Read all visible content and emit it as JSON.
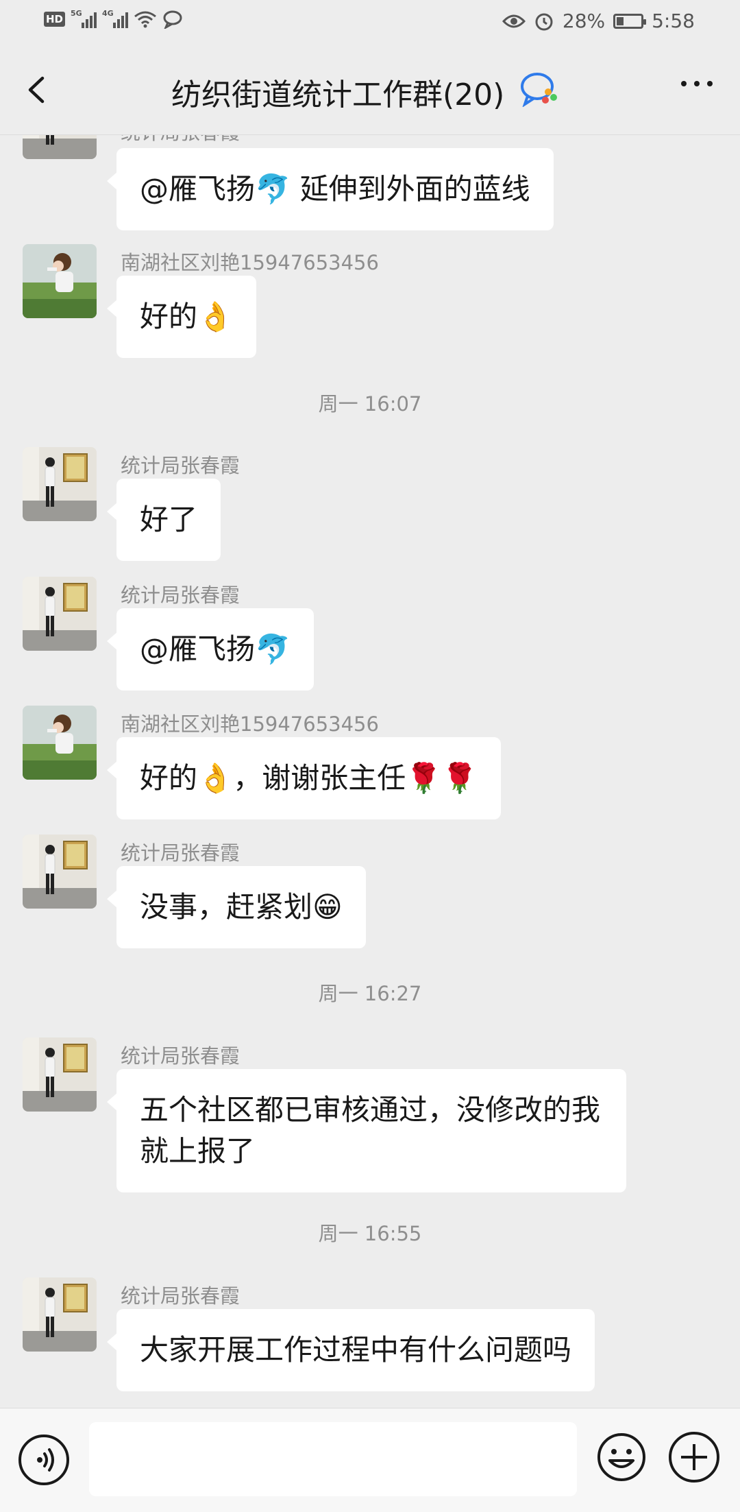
{
  "status_bar": {
    "left_badge": "HD",
    "signal1_label": "5G",
    "signal2_label": "4G",
    "battery_level": "28%",
    "battery_fraction": 0.28,
    "time": "5:58"
  },
  "header": {
    "title": "纺织街道统计工作群(20)"
  },
  "messages": [
    {
      "sender": "统计局张春霞",
      "text": "@雁飞扬🐬  延伸到外面的蓝线"
    },
    {
      "sender": "南湖社区刘艳15947653456",
      "text": "好的👌"
    },
    {
      "time": "周一 16:07"
    },
    {
      "sender": "统计局张春霞",
      "text": "好了"
    },
    {
      "sender": "统计局张春霞",
      "text": "@雁飞扬🐬"
    },
    {
      "sender": "南湖社区刘艳15947653456",
      "text": "好的👌，谢谢张主任🌹🌹"
    },
    {
      "sender": "统计局张春霞",
      "text": "没事，赶紧划😁"
    },
    {
      "time": "周一 16:27"
    },
    {
      "sender": "统计局张春霞",
      "text": "五个社区都已审核通过，没修改的我就上报了"
    },
    {
      "time": "周一 16:55"
    },
    {
      "sender": "统计局张春霞",
      "text": "大家开展工作过程中有什么问题吗"
    }
  ],
  "input": {
    "value": "",
    "placeholder": ""
  },
  "colors": {
    "background": "#ededed",
    "bubble": "#ffffff",
    "secondary_text": "#8e8e8e"
  }
}
